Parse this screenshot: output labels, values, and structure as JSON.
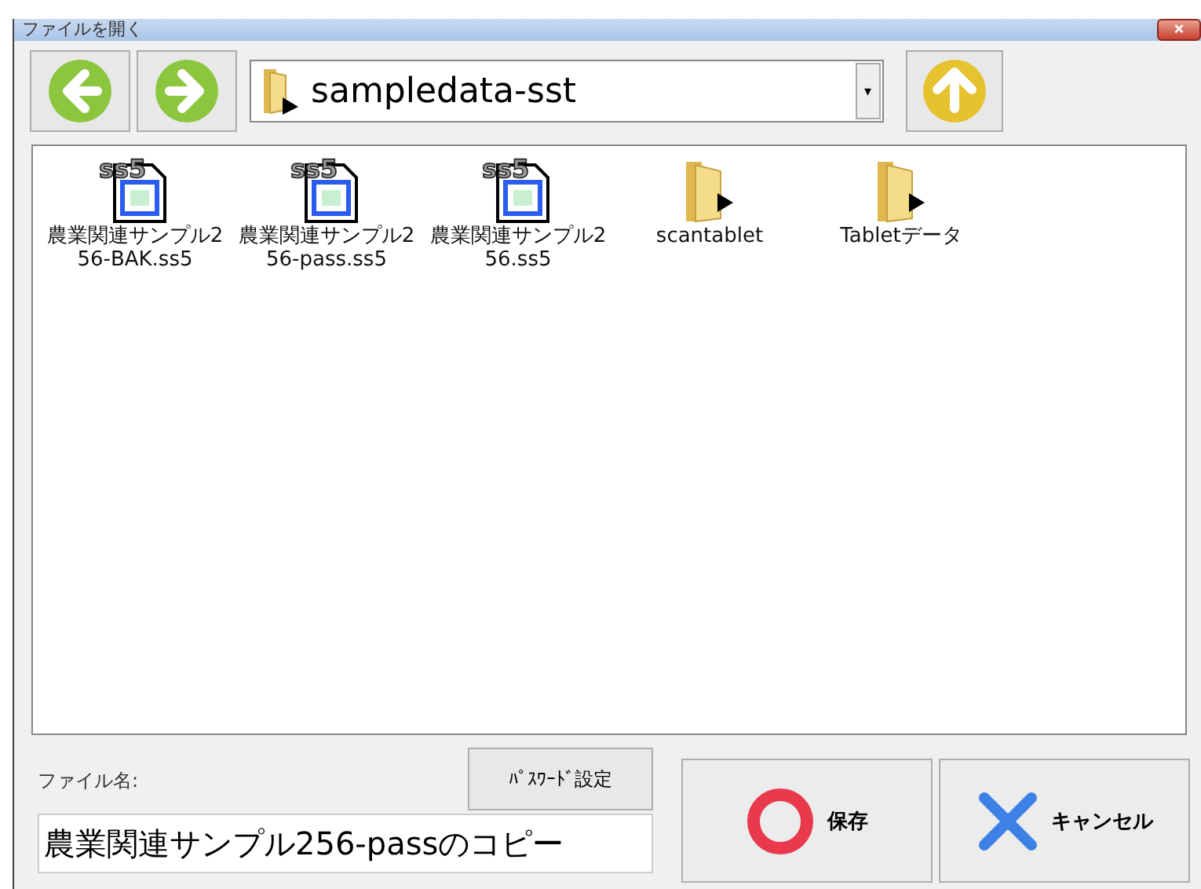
{
  "window": {
    "title": "ファイルを開く",
    "close": "×"
  },
  "path": {
    "value": "sampledata-sst",
    "dropdown": "▾"
  },
  "items": [
    {
      "kind": "file",
      "badge": "ss5",
      "name": "農業関連サンプル256-BAK.ss5"
    },
    {
      "kind": "file",
      "badge": "ss5",
      "name": "農業関連サンプル256-pass.ss5"
    },
    {
      "kind": "file",
      "badge": "ss5",
      "name": "農業関連サンプル256.ss5"
    },
    {
      "kind": "folder",
      "name": "scantablet"
    },
    {
      "kind": "folder",
      "name": "Tabletデータ"
    }
  ],
  "filename": {
    "label": "ファイル名:",
    "value": "農業関連サンプル256-passのコピー"
  },
  "buttons": {
    "password": "ﾊﾟｽﾜｰﾄﾞ設定",
    "save": "保存",
    "cancel": "キャンセル"
  }
}
